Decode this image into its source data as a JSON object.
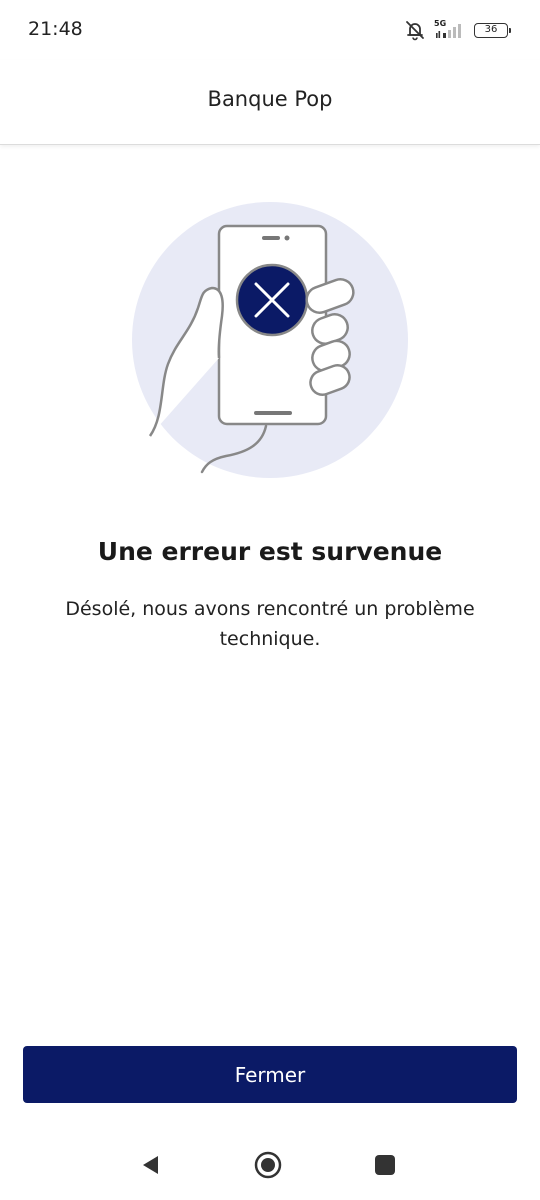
{
  "status_bar": {
    "time": "21:48",
    "network": "5G",
    "battery": "36",
    "icons": [
      "bell-muted-icon",
      "signal-icon",
      "battery-icon"
    ]
  },
  "header": {
    "title": "Banque Pop"
  },
  "illustration": {
    "icon": "hand-holding-phone-error-icon",
    "colors": {
      "circle_bg": "#e8eaf6",
      "error_badge": "#0b1a66"
    }
  },
  "error": {
    "title": "Une erreur est survenue",
    "message": "Désolé, nous avons rencontré un problème technique."
  },
  "actions": {
    "close_label": "Fermer",
    "close_color": "#0b1a66"
  },
  "nav_bar": {
    "icons": [
      "back-icon",
      "home-icon",
      "recents-icon"
    ]
  }
}
